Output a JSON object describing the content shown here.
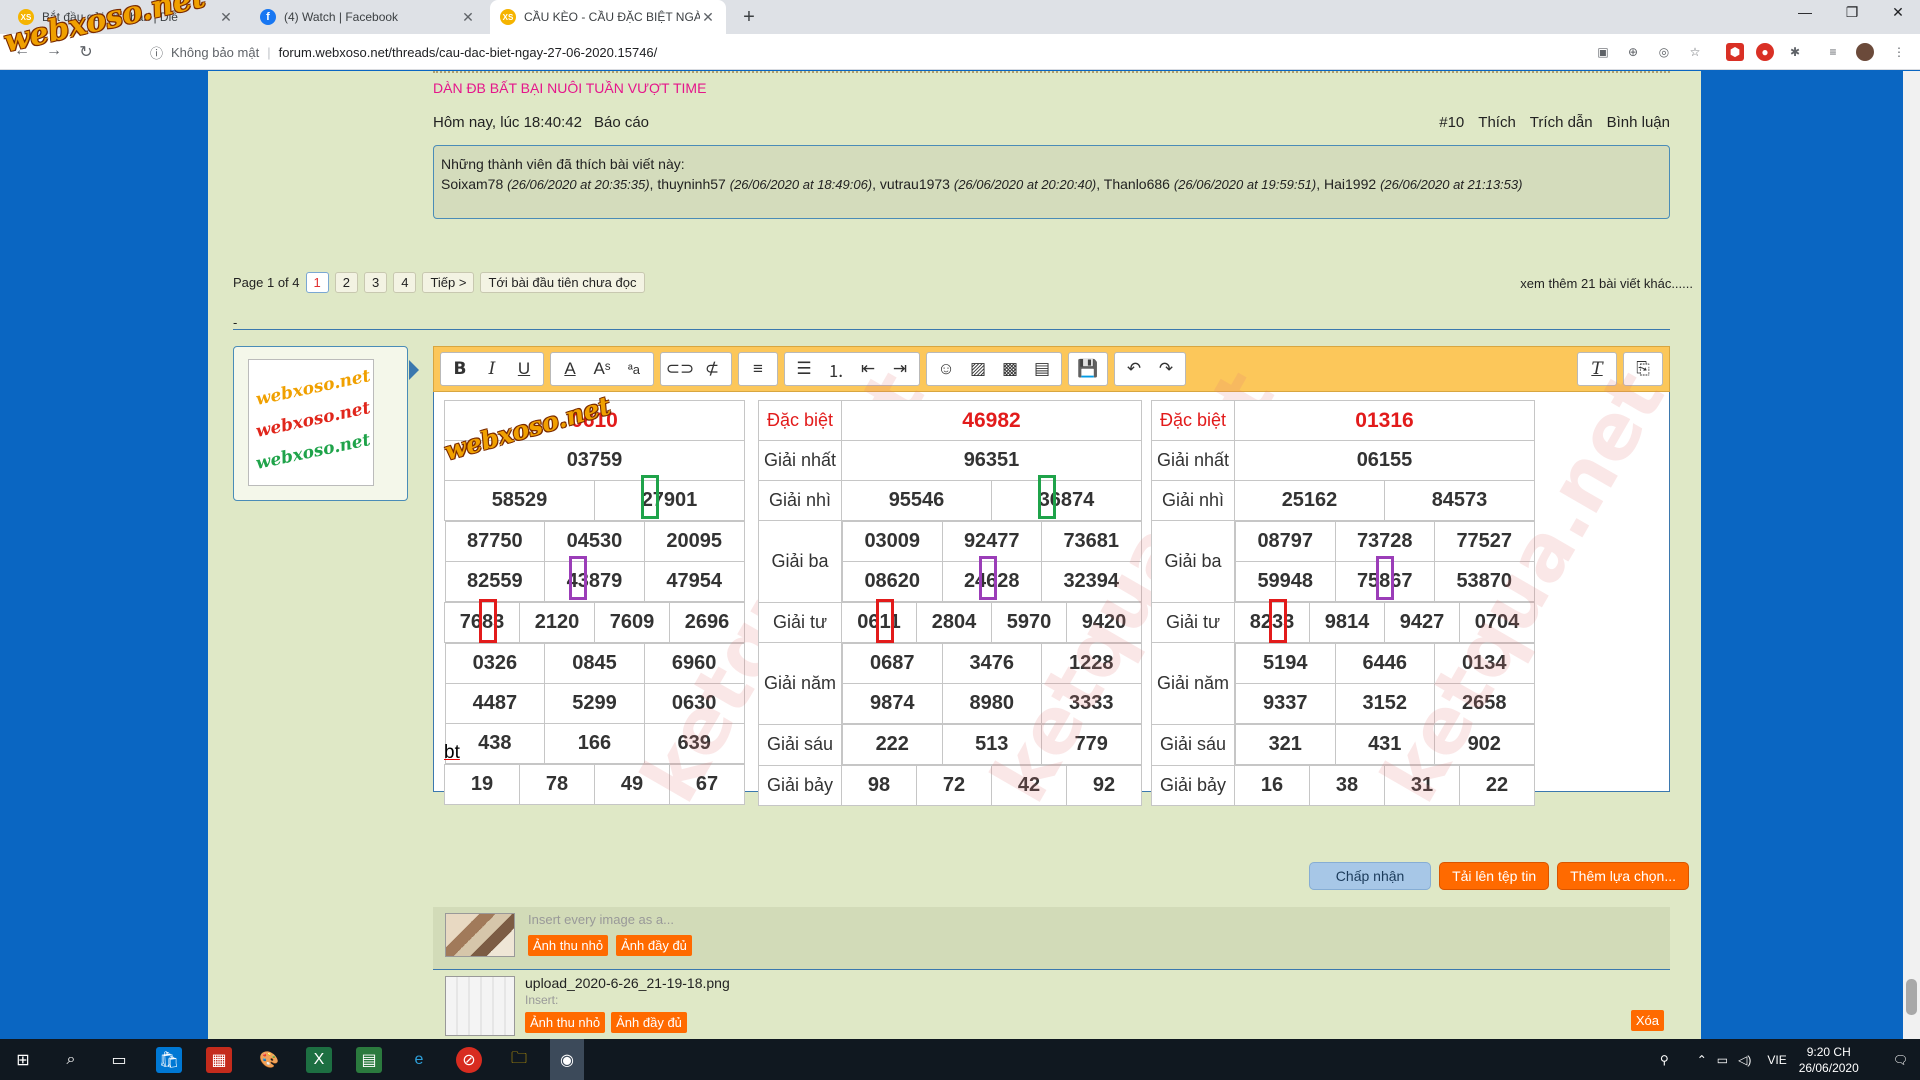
{
  "browser": {
    "tabs": [
      {
        "label": "Bắt đầu gửi tin nhắn | Diễ",
        "favicon": "xs"
      },
      {
        "label": "(4) Watch | Facebook",
        "favicon": "fb"
      },
      {
        "label": "CẦU KÈO - CẦU ĐẶC BIỆT NGÀY",
        "favicon": "xs"
      }
    ],
    "security_label": "Không bảo mật",
    "url": "forum.webxoso.net/threads/cau-dac-biet-ngay-27-06-2020.15746/"
  },
  "logo_text": "webxoso.net",
  "post": {
    "promo": "DÀN ĐB BẤT BẠI NUÔI TUẦN VƯỢT TIME",
    "time": "Hôm nay, lúc 18:40:42",
    "report": "Báo cáo",
    "number": "#10",
    "like": "Thích",
    "quote": "Trích dẫn",
    "comment": "Bình luận",
    "likes_title": "Những thành viên đã thích bài viết này:",
    "likers": [
      {
        "name": "Soixam78",
        "time": "(26/06/2020 at 20:35:35)"
      },
      {
        "name": "thuyninh57",
        "time": "(26/06/2020 at 18:49:06)"
      },
      {
        "name": "vutrau1973",
        "time": "(26/06/2020 at 20:20:40)"
      },
      {
        "name": "Thanlo686",
        "time": "(26/06/2020 at 19:59:51)"
      },
      {
        "name": "Hai1992",
        "time": "(26/06/2020 at 21:13:53)"
      }
    ]
  },
  "pager": {
    "page_info": "Page 1 of 4",
    "pages": [
      "1",
      "2",
      "3",
      "4"
    ],
    "next": "Tiếp >",
    "first_unread": "Tới bài đầu tiên chưa đọc",
    "more_posts": "xem thêm 21 bài viết khác......",
    "dash": "-"
  },
  "results": {
    "labels": [
      "Đặc biệt",
      "Giải nhất",
      "Giải nhì",
      "Giải ba",
      "Giải tư",
      "Giải năm",
      "Giải sáu",
      "Giải bảy"
    ],
    "watermark": "ketqua.net",
    "t1": {
      "db": "0610",
      "g1": "03759",
      "g2": [
        "58529",
        "27901"
      ],
      "g3": [
        "87750",
        "04530",
        "20095",
        "82559",
        "43879",
        "47954"
      ],
      "g4": [
        "7683",
        "2120",
        "7609",
        "2696"
      ],
      "g5": [
        "0326",
        "0845",
        "6960",
        "4487",
        "5299",
        "0630"
      ],
      "g6": [
        "438",
        "166",
        "639"
      ],
      "g7": [
        "19",
        "78",
        "49",
        "67"
      ]
    },
    "t2": {
      "db": "46982",
      "g1": "96351",
      "g2": [
        "95546",
        "36874"
      ],
      "g3": [
        "03009",
        "92477",
        "73681",
        "08620",
        "24628",
        "32394"
      ],
      "g4": [
        "0611",
        "2804",
        "5970",
        "9420"
      ],
      "g5": [
        "0687",
        "3476",
        "1228",
        "9874",
        "8980",
        "3333"
      ],
      "g6": [
        "222",
        "513",
        "779"
      ],
      "g7": [
        "98",
        "72",
        "42",
        "92"
      ]
    },
    "t3": {
      "db": "01316",
      "g1": "06155",
      "g2": [
        "25162",
        "84573"
      ],
      "g3": [
        "08797",
        "73728",
        "77527",
        "59948",
        "75867",
        "53870"
      ],
      "g4": [
        "8233",
        "9814",
        "9427",
        "0704"
      ],
      "g5": [
        "5194",
        "6446",
        "0134",
        "9337",
        "3152",
        "2658"
      ],
      "g6": [
        "321",
        "431",
        "902"
      ],
      "g7": [
        "16",
        "38",
        "31",
        "22"
      ]
    }
  },
  "editor": {
    "text": "bt",
    "accept": "Chấp nhận",
    "upload": "Tải lên tệp tin",
    "more_options": "Thêm lựa chọn..."
  },
  "attachments": {
    "insert_all": "Insert every image as a...",
    "thumb": "Ảnh thu nhỏ",
    "full": "Ảnh đầy đủ",
    "filename": "upload_2020-6-26_21-19-18.png",
    "insert": "Insert:",
    "delete": "Xóa"
  },
  "taskbar": {
    "time": "9:20 CH",
    "date": "26/06/2020",
    "lang": "VIE"
  }
}
